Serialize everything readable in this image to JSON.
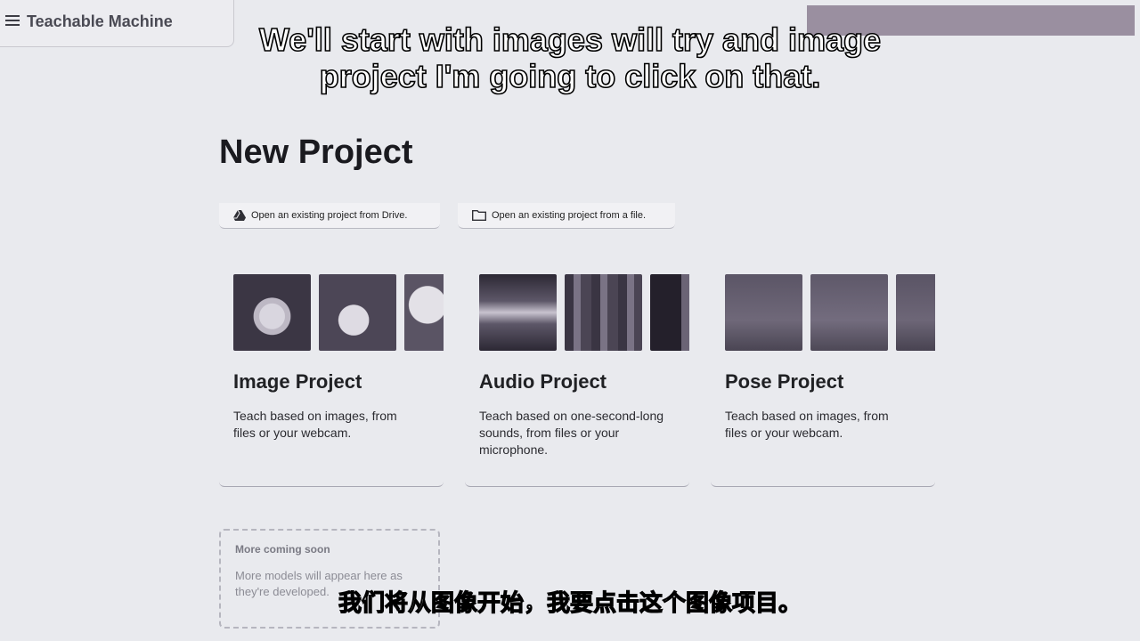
{
  "app": {
    "title": "Teachable Machine"
  },
  "captions": {
    "english": "We'll start with images will try and image project I'm going to click on that.",
    "chinese": "我们将从图像开始，我要点击这个图像项目。"
  },
  "page": {
    "title": "New Project"
  },
  "open_options": [
    {
      "label": "Open an existing project from Drive.",
      "icon": "drive-icon"
    },
    {
      "label": "Open an existing project from a file.",
      "icon": "folder-icon"
    }
  ],
  "projects": [
    {
      "title": "Image Project",
      "description": "Teach based on images, from files or your webcam."
    },
    {
      "title": "Audio Project",
      "description": "Teach based on one-second-long sounds, from files or your microphone."
    },
    {
      "title": "Pose Project",
      "description": "Teach based on images, from files or your webcam."
    }
  ],
  "coming_soon": {
    "title": "More coming soon",
    "description": "More models will appear here as they're developed."
  }
}
